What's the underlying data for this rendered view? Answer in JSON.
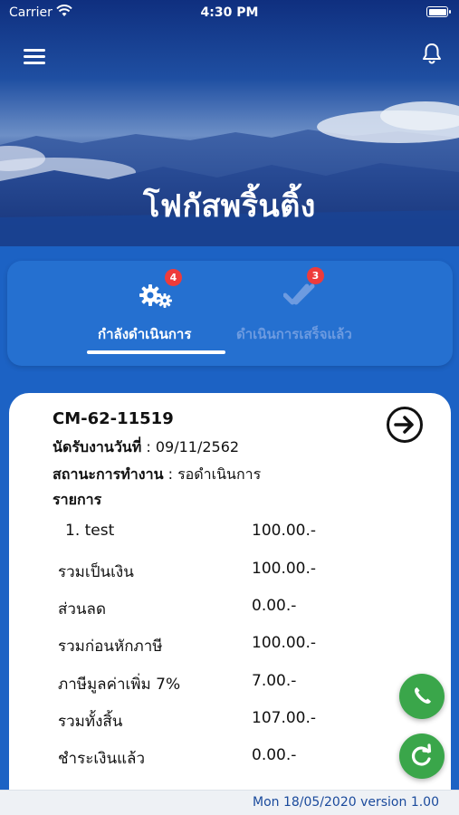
{
  "status_bar": {
    "carrier": "Carrier",
    "time": "4:30 PM"
  },
  "header": {
    "title": "โฟกัสพริ้นติ้ง"
  },
  "tabs": [
    {
      "label": "กำลังดำเนินการ",
      "badge": "4",
      "active": true
    },
    {
      "label": "ดำเนินการเสร็จแล้ว",
      "badge": "3",
      "active": false
    }
  ],
  "job": {
    "code": "CM-62-11519",
    "appointment_label": "นัดรับงานวันที่",
    "appointment_value": ": 09/11/2562",
    "status_label": "สถานะการทำงาน",
    "status_value": ": รอดำเนินการ",
    "items_title": "รายการ",
    "rows": [
      {
        "label": "1. test",
        "value": "100.00.-"
      },
      {
        "label": "รวมเป็นเงิน",
        "value": "100.00.-"
      },
      {
        "label": "ส่วนลด",
        "value": "0.00.-"
      },
      {
        "label": "รวมก่อนหักภาษี",
        "value": "100.00.-"
      },
      {
        "label": "ภาษีมูลค่าเพิ่ม 7%",
        "value": "7.00.-"
      },
      {
        "label": "รวมทั้งสิ้น",
        "value": "107.00.-"
      },
      {
        "label": "ชำระเงินแล้ว",
        "value": "0.00.-"
      }
    ]
  },
  "footer": {
    "text": "Mon 18/05/2020 version 1.00"
  },
  "icons": {
    "menu": "hamburger-menu-icon",
    "bell": "bell-icon",
    "gears": "gears-icon",
    "check": "double-check-icon",
    "arrow": "arrow-right-circle-icon",
    "phone": "phone-icon",
    "refresh": "refresh-icon"
  },
  "colors": {
    "primary_blue": "#1c62c4",
    "badge_red": "#ee3b3b",
    "fab_green": "#3aa64a",
    "footer_text": "#1a4a9c"
  }
}
